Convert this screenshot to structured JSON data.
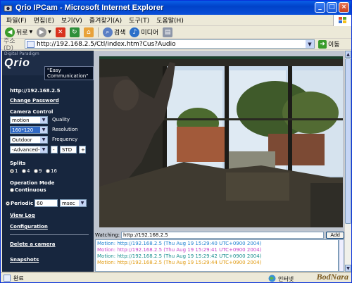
{
  "window": {
    "title": "Qrio IPCam - Microsoft Internet Explorer",
    "controls": [
      "_",
      "□",
      "×"
    ]
  },
  "menu": [
    "파일(F)",
    "편집(E)",
    "보기(V)",
    "즐겨찾기(A)",
    "도구(T)",
    "도움말(H)"
  ],
  "toolbar": {
    "back": "뒤로",
    "search": "검색",
    "media": "미디어"
  },
  "address": {
    "label": "주소(D)",
    "url": "http://192.168.2.5/Ctl/index.htm?Cus?Audio",
    "go": "이동"
  },
  "sidebar": {
    "tagline": "Digital Paradigm",
    "logo": "Qrio",
    "slogan": "\"Easy Communication\"",
    "host": "http://192.168.2.5",
    "change_password": "Change Password",
    "camera_control": "Camera Control",
    "quality_value": "motion",
    "quality_label": "Quality",
    "resolution_value": "160*120",
    "resolution_label": "Resolution",
    "frequency_value": "Outdoor",
    "frequency_label": "Frequency",
    "advanced_value": "-Advanced-",
    "minus_btn": "-",
    "std_value": "STD",
    "plus_btn": "+",
    "splits_label": "Splits",
    "splits": [
      "1",
      "4",
      "9",
      "16"
    ],
    "operation_mode": "Operation Mode",
    "continuous": "Continuous",
    "periodic": "Periodic",
    "periodic_value": "60",
    "periodic_unit": "msec",
    "view_log": "View Log",
    "configuration": "Configuration",
    "delete_camera": "Delete a camera",
    "snapshots": "Snapshots"
  },
  "watching": {
    "label": "Watching:",
    "value": "http://192.168.2.5",
    "add": "Add"
  },
  "log": [
    {
      "text": "Motion: http://192.168.2.5 (Thu Aug 19 15:29:40 UTC+0900 2004)",
      "color": "#1a7fd0"
    },
    {
      "text": "Motion: http://192.168.2.5 (Thu Aug 19 15:29:41 UTC+0900 2004)",
      "color": "#c83fc8"
    },
    {
      "text": "Motion: http://192.168.2.5 (Thu Aug 19 15:29:42 UTC+0900 2004)",
      "color": "#1a8f8f"
    },
    {
      "text": "Motion: http://192.168.2.5 (Thu Aug 19 15:29:44 UTC+0900 2004)",
      "color": "#e09a10"
    }
  ],
  "status": {
    "left": "완료",
    "zone": "인터넷"
  },
  "watermark": "BodNara"
}
